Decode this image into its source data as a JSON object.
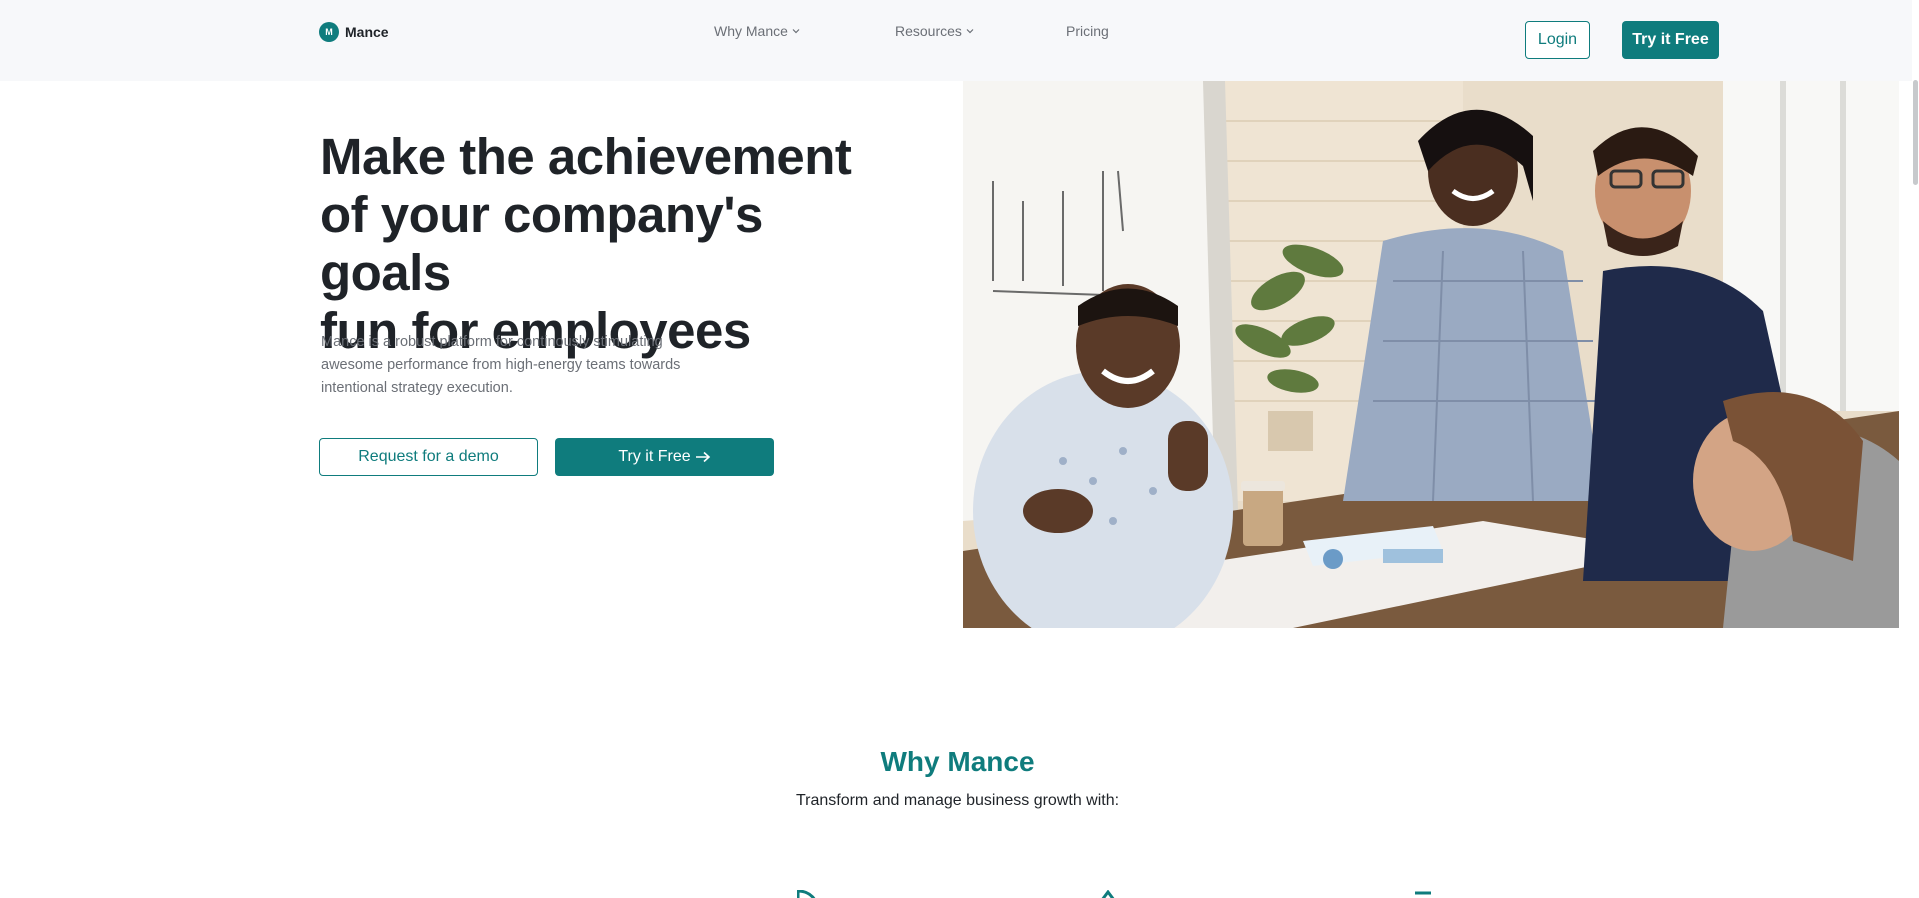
{
  "nav": {
    "brand_initial": "M",
    "brand_name": "Mance",
    "items": [
      {
        "label": "Why Mance",
        "has_dropdown": true
      },
      {
        "label": "Resources",
        "has_dropdown": true
      },
      {
        "label": "Pricing",
        "has_dropdown": false
      }
    ],
    "login_label": "Login",
    "try_label": "Try it Free"
  },
  "hero": {
    "title_lines": [
      "Make the achievement",
      "of your company's goals",
      "fun for employees"
    ],
    "description_lines": [
      "Mance is a robust platform for continously stimulating",
      "awesome performance from high-energy teams towards",
      "intentional strategy execution."
    ],
    "demo_button": "Request for a demo",
    "try_button": "Try it Free"
  },
  "why": {
    "title": "Why Mance",
    "subtitle": "Transform and manage business growth with:"
  },
  "colors": {
    "accent": "#0f7c7d",
    "nav_bg": "#f7f8fa",
    "text_dark": "#1f2328",
    "text_muted": "#6b6f76"
  },
  "icons": {
    "brand_logo": "mance-logo-icon",
    "dropdown": "chevron-down-icon",
    "arrow": "arrow-right-icon"
  }
}
